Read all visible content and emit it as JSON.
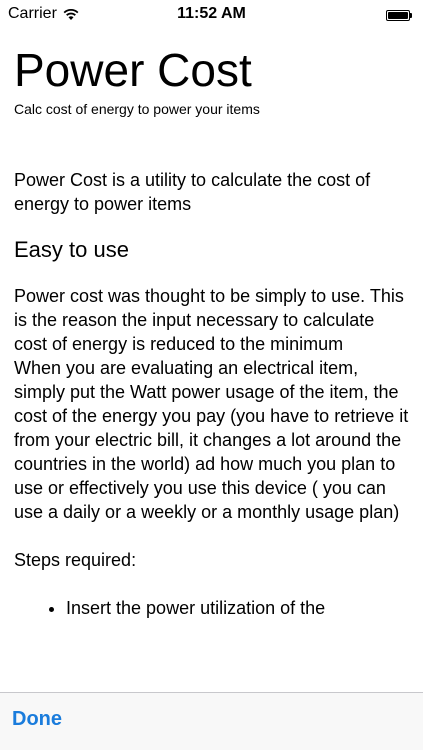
{
  "status_bar": {
    "carrier": "Carrier",
    "time": "11:52 AM",
    "wifi_icon": "wifi-icon",
    "battery_icon": "battery-icon"
  },
  "content": {
    "title": "Power Cost",
    "subtitle": "Calc cost of energy to power your items",
    "intro": "Power Cost is a utility to calculate the cost of energy to power items",
    "section_heading": "Easy to use",
    "para1": "Power cost was thought to be simply to use. This is the reason the input necessary to calculate cost of energy is reduced to the minimum",
    "para2": "When you are evaluating an electrical item, simply put the Watt power usage of the item, the cost of the energy you pay (you have to retrieve it from your electric bill, it changes a lot around the countries in the world) ad how much you plan to use or effectively you use this device ( you can use a daily or a weekly or a monthly usage plan)",
    "steps_label": "Steps required:",
    "steps": [
      "Insert the power utilization of the"
    ]
  },
  "toolbar": {
    "done_label": "Done"
  },
  "colors": {
    "accent": "#1a7cdc",
    "toolbar_bg": "#f8f8f8"
  }
}
